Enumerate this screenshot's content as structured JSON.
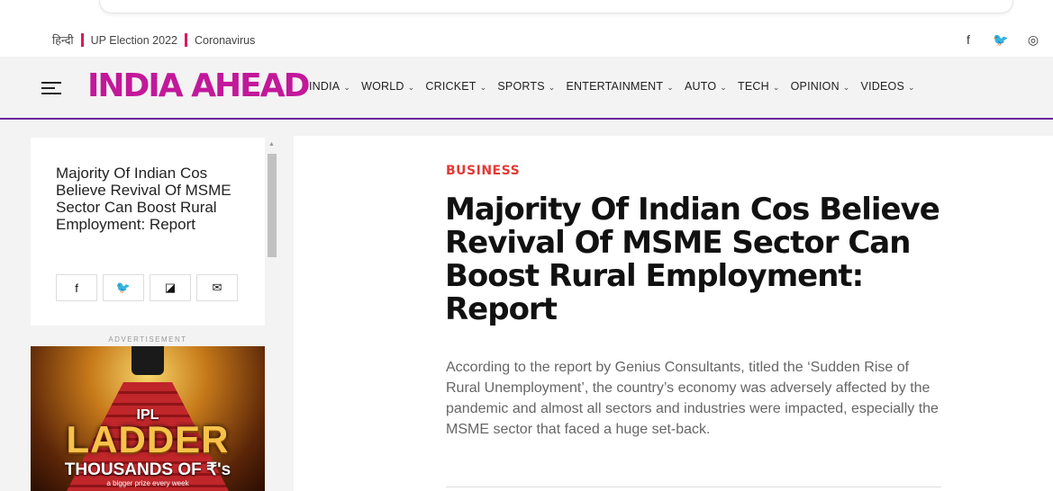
{
  "utility": {
    "links": [
      "हिन्दी",
      "UP Election 2022",
      "Coronavirus"
    ],
    "social": [
      {
        "name": "facebook-icon",
        "glyph": "f"
      },
      {
        "name": "twitter-icon",
        "glyph": "🐦"
      },
      {
        "name": "instagram-icon",
        "glyph": "◎"
      }
    ]
  },
  "header": {
    "logo": "INDIA AHEAD",
    "nav": [
      {
        "label": "INDIA"
      },
      {
        "label": "WORLD"
      },
      {
        "label": "CRICKET"
      },
      {
        "label": "SPORTS"
      },
      {
        "label": "ENTERTAINMENT"
      },
      {
        "label": "AUTO"
      },
      {
        "label": "TECH"
      },
      {
        "label": "OPINION"
      },
      {
        "label": "VIDEOS"
      }
    ],
    "chevron": "⌄"
  },
  "sidebar": {
    "title": "Majority Of Indian Cos Believe Revival Of MSME Sector Can Boost Rural Employment: Report",
    "share_icons": [
      {
        "name": "facebook-icon",
        "glyph": "f"
      },
      {
        "name": "twitter-icon",
        "glyph": "🐦"
      },
      {
        "name": "flipboard-icon",
        "glyph": "◪"
      },
      {
        "name": "email-icon",
        "glyph": "✉"
      }
    ],
    "ad_label": "ADVERTISEMENT"
  },
  "ad": {
    "ipl": "IPL",
    "ladder": "LADDER",
    "thousands": "THOUSANDS OF ₹'s",
    "sub": "a bigger prize every week"
  },
  "article": {
    "category": "BUSINESS",
    "headline": "Majority Of Indian Cos Believe Revival Of MSME Sector Can Boost Rural Employment: Report",
    "summary": "According to the report by Genius Consultants, titled the ‘Sudden Rise of Rural Unemployment’, the country’s economy was adversely affected by the pandemic and almost all sectors and industries were impacted, especially the MSME sector that faced a huge set-back."
  },
  "colors": {
    "logo": "#c2189a",
    "nav_border": "#6a1b9a",
    "category": "#e53935",
    "link_separator": "#d81b60"
  }
}
